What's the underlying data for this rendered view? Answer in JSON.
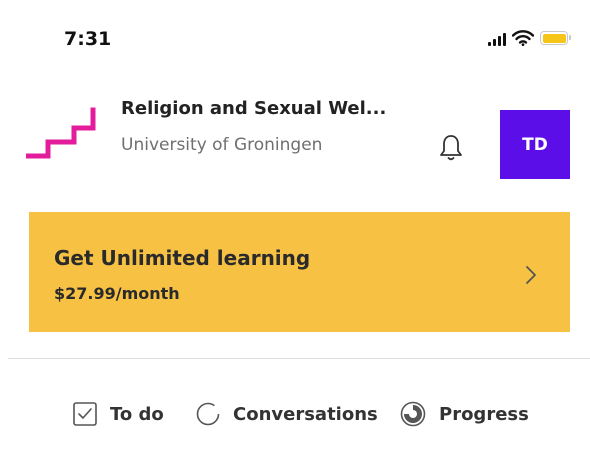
{
  "status_bar": {
    "time": "7:31",
    "signal_icon": "signal-bars-icon",
    "wifi_icon": "wifi-icon",
    "battery_icon": "battery-icon",
    "battery_color": "#f5c518"
  },
  "course": {
    "title": "Religion and Sexual Wel...",
    "institution": "University of Groningen",
    "logo_icon": "staircase-logo-icon",
    "logo_color": "#e31c9c"
  },
  "header": {
    "bell_icon": "bell-icon",
    "avatar_initials": "TD",
    "avatar_color": "#5b0ee8"
  },
  "promo": {
    "title": "Get Unlimited learning",
    "price": "$27.99/month",
    "background_color": "#f7c244",
    "chevron_icon": "chevron-right-icon"
  },
  "tabs": [
    {
      "label": "To do",
      "icon": "checkbox-icon"
    },
    {
      "label": "Conversations",
      "icon": "circle-icon"
    },
    {
      "label": "Progress",
      "icon": "progress-ring-icon"
    }
  ]
}
